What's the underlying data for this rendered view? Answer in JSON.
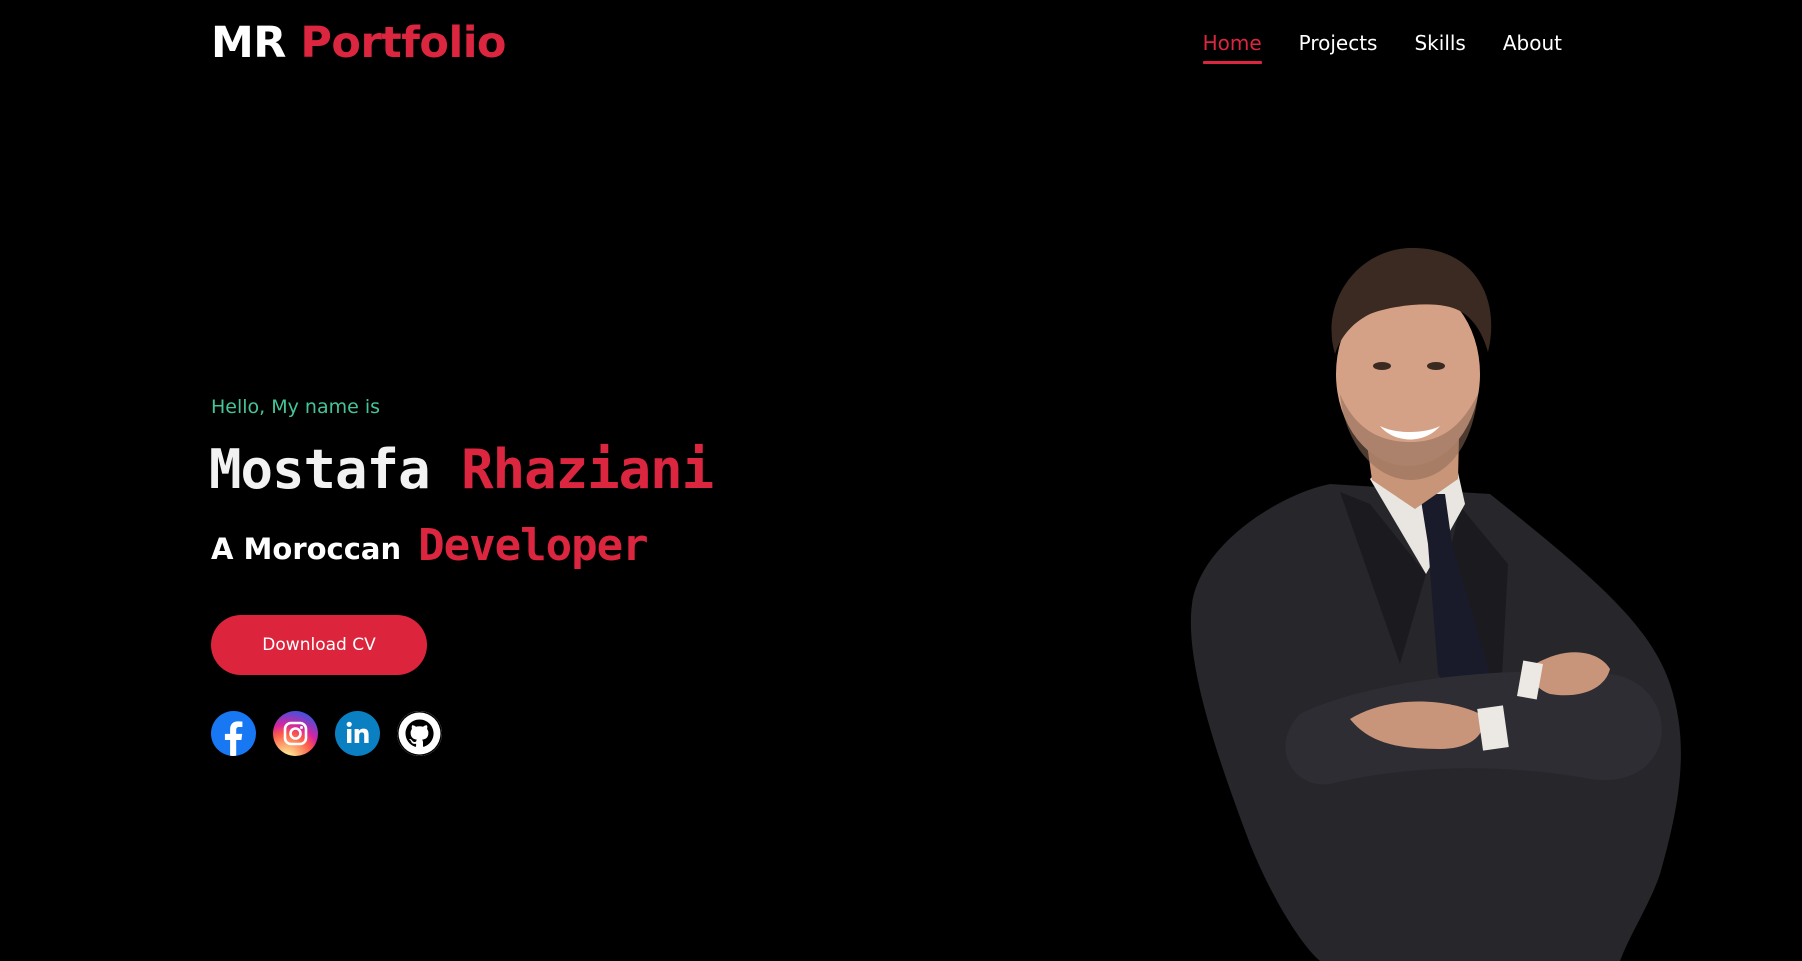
{
  "header": {
    "logo_first": "MR",
    "logo_second": "Portfolio",
    "nav": [
      {
        "label": "Home",
        "active": true
      },
      {
        "label": "Projects",
        "active": false
      },
      {
        "label": "Skills",
        "active": false
      },
      {
        "label": "About",
        "active": false
      }
    ]
  },
  "hero": {
    "greeting": "Hello, My name is",
    "first_name": "Mostafa",
    "last_name": "Rhaziani",
    "role_prefix": "A Moroccan",
    "role": "Developer",
    "cv_button": "Download CV",
    "socials": [
      "facebook-icon",
      "instagram-icon",
      "linkedin-icon",
      "github-icon"
    ]
  },
  "colors": {
    "background": "#000000",
    "accent": "#dc2640",
    "greeting": "#45c49a",
    "text": "#ffffff"
  }
}
